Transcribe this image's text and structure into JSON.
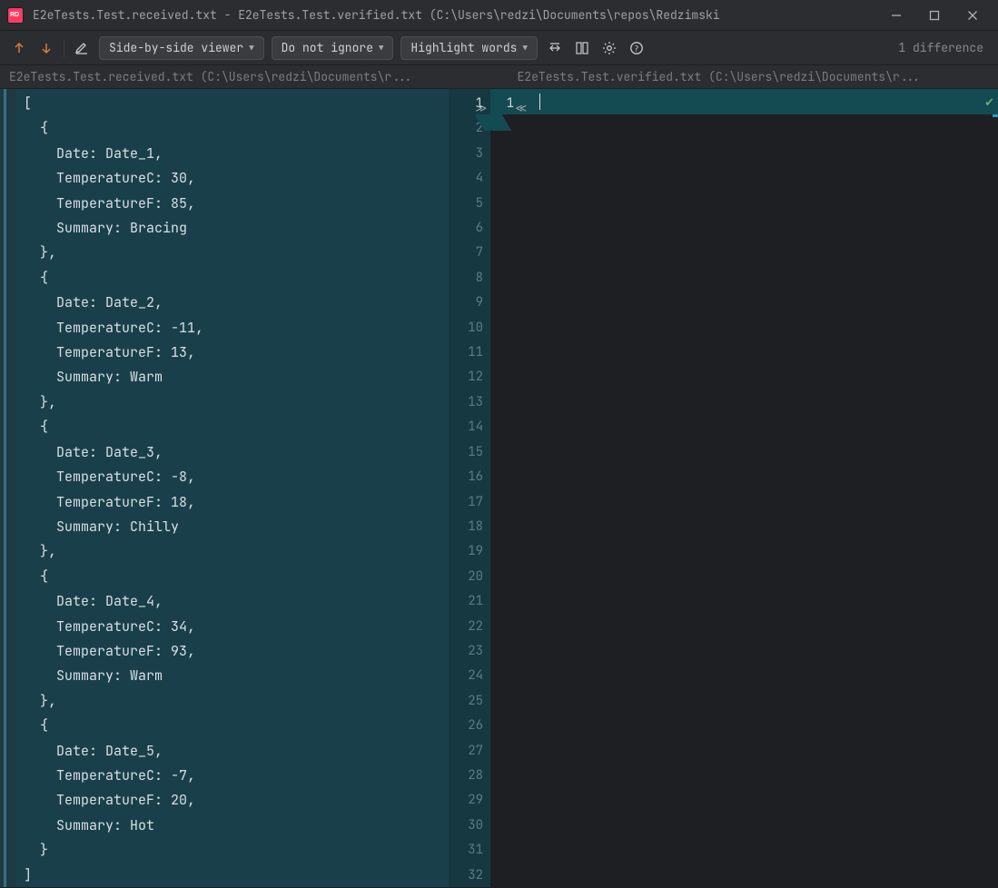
{
  "window": {
    "title": "E2eTests.Test.received.txt - E2eTests.Test.verified.txt (C:\\Users\\redzi\\Documents\\repos\\Redzimski"
  },
  "toolbar": {
    "viewer_mode": "Side-by-side viewer",
    "ignore_mode": "Do not ignore",
    "highlight_mode": "Highlight words",
    "status": "1 difference"
  },
  "files": {
    "left_header": "E2eTests.Test.received.txt (C:\\Users\\redzi\\Documents\\r...",
    "right_header": "E2eTests.Test.verified.txt (C:\\Users\\redzi\\Documents\\r..."
  },
  "left_code_lines": [
    "[",
    "  {",
    "    Date: Date_1,",
    "    TemperatureC: 30,",
    "    TemperatureF: 85,",
    "    Summary: Bracing",
    "  },",
    "  {",
    "    Date: Date_2,",
    "    TemperatureC: -11,",
    "    TemperatureF: 13,",
    "    Summary: Warm",
    "  },",
    "  {",
    "    Date: Date_3,",
    "    TemperatureC: -8,",
    "    TemperatureF: 18,",
    "    Summary: Chilly",
    "  },",
    "  {",
    "    Date: Date_4,",
    "    TemperatureC: 34,",
    "    TemperatureF: 93,",
    "    Summary: Warm",
    "  },",
    "  {",
    "    Date: Date_5,",
    "    TemperatureC: -7,",
    "    TemperatureF: 20,",
    "    Summary: Hot",
    "  }",
    "]"
  ],
  "left_line_numbers": [
    "1",
    "2",
    "3",
    "4",
    "5",
    "6",
    "7",
    "8",
    "9",
    "10",
    "11",
    "12",
    "13",
    "14",
    "15",
    "16",
    "17",
    "18",
    "19",
    "20",
    "21",
    "22",
    "23",
    "24",
    "25",
    "26",
    "27",
    "28",
    "29",
    "30",
    "31",
    "32"
  ],
  "right_line_number": "1"
}
